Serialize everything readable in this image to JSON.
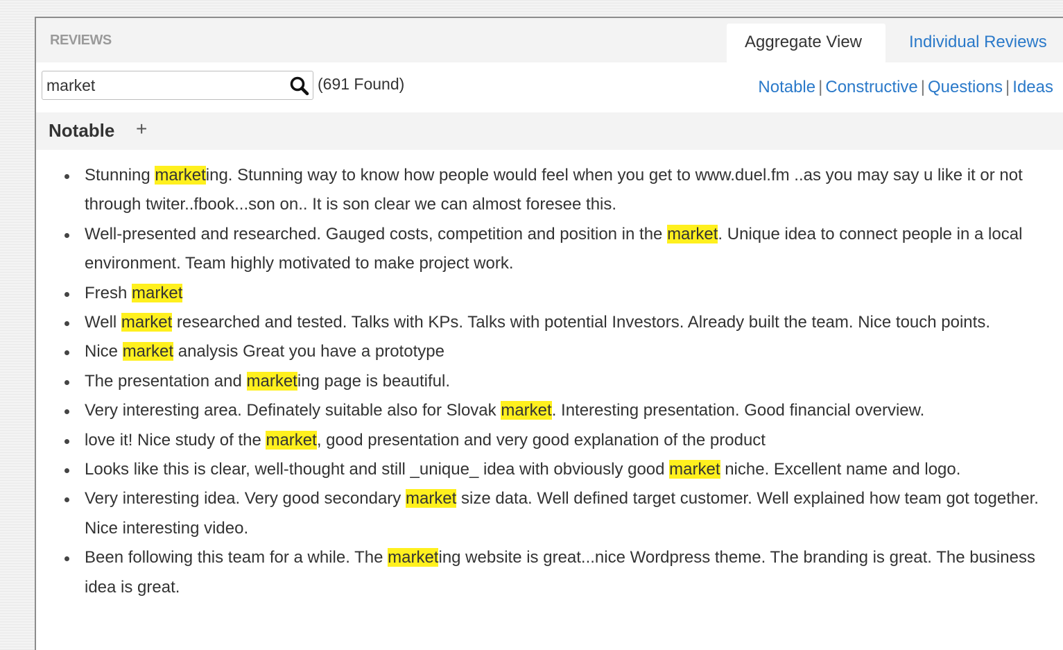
{
  "header": {
    "section_label": "REVIEWS",
    "tabs": [
      {
        "label": "Aggregate View",
        "active": true
      },
      {
        "label": "Individual Reviews",
        "active": false
      }
    ]
  },
  "search": {
    "value": "market",
    "placeholder": "",
    "icon": "search-icon",
    "found_text": "(691 Found)"
  },
  "filters": [
    "Notable",
    "Constructive",
    "Questions",
    "Ideas"
  ],
  "section": {
    "title": "Notable",
    "expand_icon": "plus-icon"
  },
  "highlight_color": "#fff01e",
  "link_color": "#2a79c9",
  "reviews": [
    {
      "before": "Stunning ",
      "match": "market",
      "after": "ing. Stunning way to know how people would feel when you get to www.duel.fm ..as you may say u like it or not through twiter..fbook...son on..  It is son clear we can almost foresee this."
    },
    {
      "before": "Well-presented and researched.  Gauged costs, competition and position in the ",
      "match": "market",
      "after": ". Unique idea to connect people in a local environment. Team highly motivated to make project work."
    },
    {
      "before": "Fresh ",
      "match": "market",
      "after": ""
    },
    {
      "before": "Well ",
      "match": "market",
      "after": " researched and tested. Talks with KPs. Talks with potential Investors. Already built the team. Nice touch points."
    },
    {
      "before": "Nice ",
      "match": "market",
      "after": " analysis Great you have a prototype"
    },
    {
      "before": "The presentation and ",
      "match": "market",
      "after": "ing page is beautiful."
    },
    {
      "before": "Very interesting area. Definately suitable also for Slovak ",
      "match": "market",
      "after": ". Interesting presentation. Good financial overview."
    },
    {
      "before": "love it!  Nice study of the ",
      "match": "market",
      "after": ", good presentation and very good explanation of the product"
    },
    {
      "before": "Looks like this is clear, well-thought and still _unique_ idea with obviously good ",
      "match": "market",
      "after": " niche. Excellent name and logo."
    },
    {
      "before": "Very interesting idea. Very good secondary ",
      "match": "market",
      "after": " size data. Well defined target customer. Well explained how team got together. Nice interesting video."
    },
    {
      "before": "Been following this team for a while. The ",
      "match": "market",
      "after": "ing website is great...nice Wordpress theme. The branding is great. The business idea is great."
    }
  ]
}
